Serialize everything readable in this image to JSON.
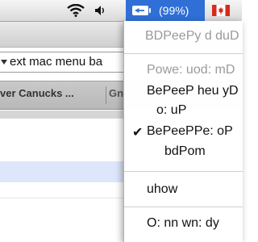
{
  "menubar": {
    "wifi_icon": "wifi-icon",
    "volume_icon": "volume-icon",
    "battery_percent": "(99%)",
    "flag_icon": "canada-flag-icon",
    "accent_color": "#2f6fd6"
  },
  "browser": {
    "search_text": "ext mac menu ba",
    "tab1_label": "ver Canucks ...",
    "tab2_label": "Gn"
  },
  "battery_menu": {
    "items": [
      {
        "label": "BDPeePy  d duD",
        "enabled": false
      },
      {
        "label": "Powe: uod:  mD",
        "enabled": false
      },
      {
        "label": "BePeeP  heu yD",
        "enabled": true
      },
      {
        "label": "o:   uP",
        "enabled": true
      },
      {
        "label": "BePeePPe:  oP",
        "enabled": true,
        "checked": true
      },
      {
        "label": "bdPom",
        "enabled": true
      },
      {
        "label": "uhow",
        "enabled": true
      },
      {
        "label": "O: nn   wn: dy",
        "enabled": true
      }
    ],
    "checkmark": "✔"
  }
}
